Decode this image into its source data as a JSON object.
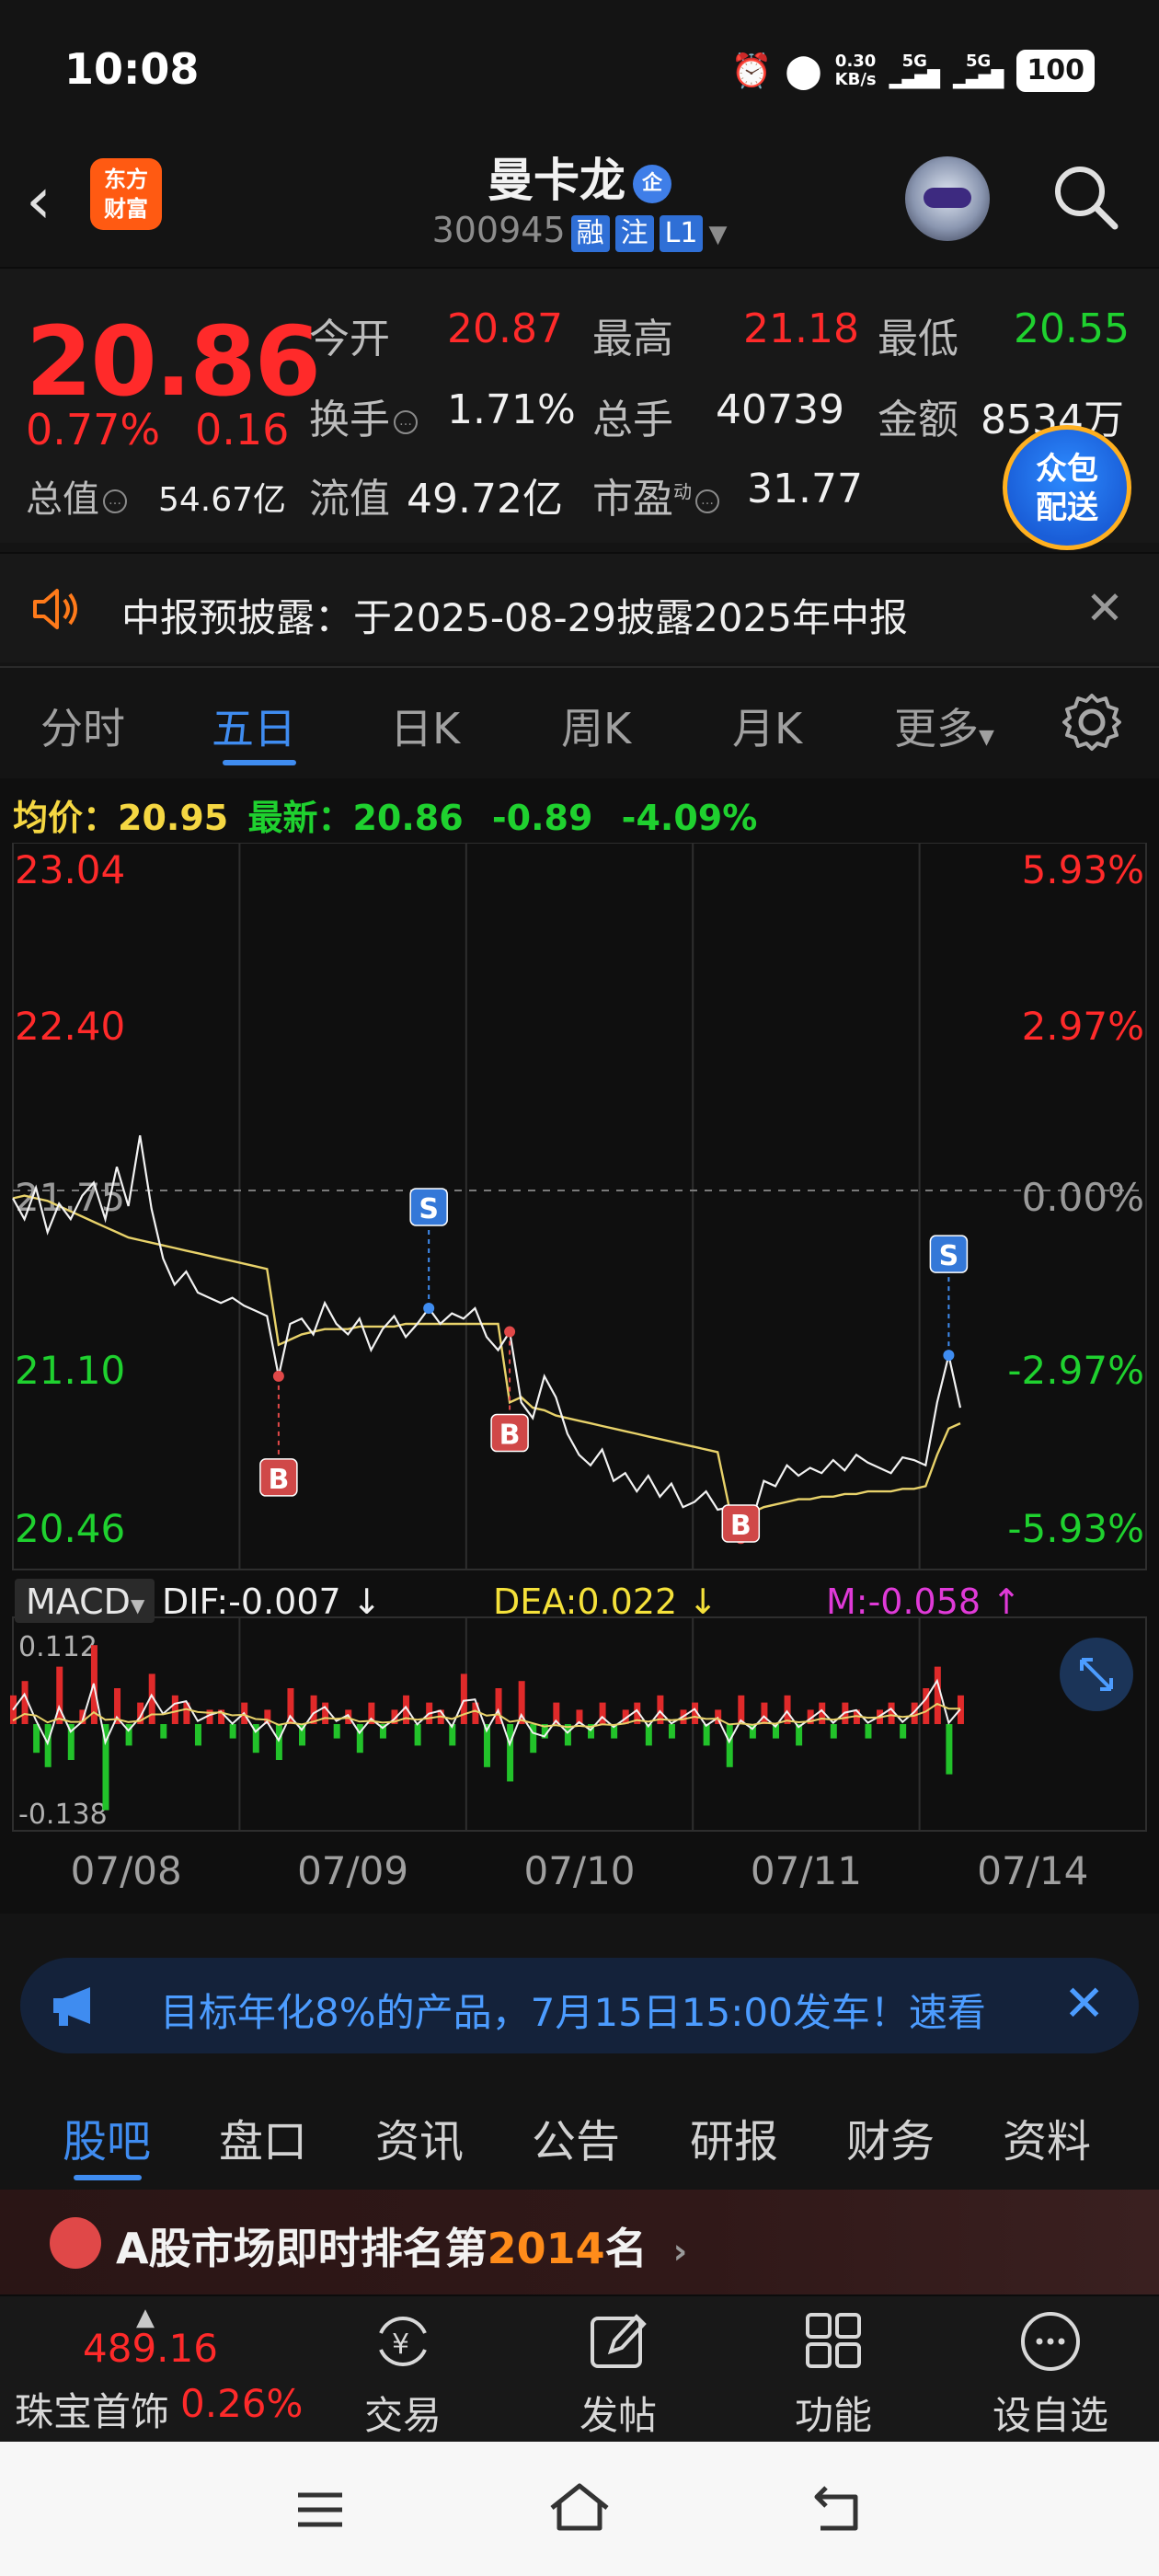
{
  "status_bar": {
    "time": "10:08",
    "net_speed_top": "0.30",
    "net_speed_unit": "KB/s",
    "signal1": "5G",
    "signal2": "5G",
    "battery": "100"
  },
  "header": {
    "logo_line1": "东方",
    "logo_line2": "财富",
    "stock_name": "曼卡龙",
    "name_badge": "企",
    "code": "300945",
    "tags": [
      "融",
      "注",
      "L1"
    ]
  },
  "quote": {
    "price": "20.86",
    "change_pct": "0.77%",
    "change": "0.16",
    "rows": [
      [
        {
          "label": "今开",
          "value": "20.87",
          "color": "#ff2a2a"
        },
        {
          "label": "最高",
          "value": "21.18",
          "color": "#ff2a2a"
        },
        {
          "label": "最低",
          "value": "20.55",
          "color": "#1fd12f"
        }
      ],
      [
        {
          "label": "换手",
          "value": "1.71%",
          "color": "#f0f0f0"
        },
        {
          "label": "总手",
          "value": "40739",
          "color": "#f0f0f0"
        },
        {
          "label": "金额",
          "value": "8534万",
          "color": "#f0f0f0"
        }
      ],
      [
        {
          "label": "总值",
          "value": "54.67亿",
          "color": "#f0f0f0"
        },
        {
          "label": "流值",
          "value": "49.72亿",
          "color": "#f0f0f0"
        },
        {
          "label": "市盈",
          "value": "31.77",
          "color": "#f0f0f0"
        }
      ]
    ],
    "pe_superscript": "动",
    "promo_line1": "众包",
    "promo_line2": "配送"
  },
  "notice": {
    "text": "中报预披露：于2025-08-29披露2025年中报"
  },
  "chart_tabs": {
    "items": [
      "分时",
      "五日",
      "日K",
      "周K",
      "月K",
      "更多"
    ],
    "active": "五日"
  },
  "summary": {
    "avg_label": "均价：",
    "avg_value": "20.95",
    "latest_label": "最新：",
    "latest_value": "20.86",
    "change": "-0.89",
    "change_pct": "-4.09%"
  },
  "macd": {
    "label": "MACD",
    "dif": "DIF:-0.007",
    "dea": "DEA:0.022",
    "m": "M:-0.058",
    "top_tick": "0.112",
    "bottom_tick": "-0.138"
  },
  "chart_data": {
    "type": "line",
    "left_ticks": [
      "23.04",
      "22.40",
      "21.75",
      "21.10",
      "20.46"
    ],
    "right_ticks": [
      "5.93%",
      "2.97%",
      "0.00%",
      "-2.97%",
      "-5.93%"
    ],
    "ylim": [
      20.46,
      23.04
    ],
    "x_labels": [
      "07/08",
      "07/09",
      "07/10",
      "07/11",
      "07/14"
    ],
    "series": [
      {
        "values": [
          21.78,
          21.7,
          21.82,
          21.65,
          21.76,
          21.7,
          21.79,
          21.84,
          21.7,
          21.9,
          21.75,
          22.02,
          21.74,
          21.55,
          21.45,
          21.5,
          21.42,
          21.4,
          21.38,
          21.4,
          21.37,
          21.35,
          21.33,
          21.1,
          21.3,
          21.32,
          21.26,
          21.38,
          21.3,
          21.26,
          21.32,
          21.2,
          21.28,
          21.33,
          21.25,
          21.3,
          21.36,
          21.3,
          21.34,
          21.32,
          21.36,
          21.25,
          21.2,
          21.27,
          21.0,
          20.94,
          21.1,
          21.02,
          20.88,
          20.8,
          20.76,
          20.82,
          20.7,
          20.73,
          20.66,
          20.72,
          20.64,
          20.69,
          20.6,
          20.62,
          20.66,
          20.59,
          20.6,
          20.48,
          20.55,
          20.7,
          20.68,
          20.76,
          20.72,
          20.75,
          20.73,
          20.78,
          20.74,
          20.8,
          20.77,
          20.75,
          20.73,
          20.79,
          20.78,
          20.76,
          21.0,
          21.18,
          20.98
        ]
      },
      {
        "values": [
          21.78,
          21.79,
          21.78,
          21.77,
          21.75,
          21.73,
          21.71,
          21.69,
          21.67,
          21.65,
          21.63,
          21.62,
          21.61,
          21.6,
          21.59,
          21.58,
          21.57,
          21.56,
          21.55,
          21.54,
          21.53,
          21.52,
          21.51,
          21.22,
          21.24,
          21.26,
          21.27,
          21.28,
          21.28,
          21.28,
          21.29,
          21.29,
          21.29,
          21.29,
          21.3,
          21.3,
          21.3,
          21.3,
          21.3,
          21.3,
          21.3,
          21.3,
          21.3,
          21.0,
          21.02,
          20.98,
          20.97,
          20.95,
          20.94,
          20.93,
          20.92,
          20.91,
          20.9,
          20.89,
          20.88,
          20.87,
          20.86,
          20.85,
          20.84,
          20.83,
          20.82,
          20.81,
          20.6,
          20.58,
          20.58,
          20.6,
          20.61,
          20.62,
          20.63,
          20.63,
          20.64,
          20.64,
          20.65,
          20.65,
          20.66,
          20.66,
          20.66,
          20.67,
          20.67,
          20.68,
          20.8,
          20.9,
          20.92
        ]
      }
    ],
    "trade_markers": [
      {
        "type": "B",
        "index": 23
      },
      {
        "type": "S",
        "index": 36
      },
      {
        "type": "B",
        "index": 43
      },
      {
        "type": "B",
        "index": 63
      },
      {
        "type": "S",
        "index": 81
      }
    ],
    "macd_bars": [
      0.04,
      0.06,
      -0.04,
      -0.06,
      0.08,
      -0.05,
      0.02,
      0.11,
      -0.12,
      0.05,
      -0.03,
      0.03,
      0.07,
      -0.02,
      0.04,
      0.03,
      -0.03,
      0.02,
      0.02,
      -0.02,
      0.03,
      -0.04,
      0.02,
      -0.05,
      0.05,
      -0.03,
      0.04,
      0.03,
      -0.02,
      0.02,
      -0.04,
      0.03,
      -0.02,
      0.02,
      0.04,
      -0.03,
      0.03,
      0.02,
      -0.03,
      0.07,
      0.03,
      -0.06,
      0.05,
      -0.08,
      0.06,
      -0.04,
      -0.02,
      0.03,
      -0.03,
      0.02,
      -0.02,
      0.03,
      -0.02,
      0.02,
      0.03,
      -0.03,
      0.04,
      -0.02,
      0.02,
      0.03,
      -0.03,
      0.02,
      -0.06,
      0.04,
      -0.02,
      0.03,
      -0.02,
      0.04,
      -0.03,
      0.02,
      0.03,
      -0.02,
      0.03,
      0.02,
      -0.02,
      0.02,
      0.03,
      -0.02,
      0.03,
      0.05,
      0.08,
      -0.07,
      0.04
    ]
  },
  "banner": {
    "text": "目标年化8%的产品，7月15日15:00发车！速看"
  },
  "sub_tabs": {
    "items": [
      "股吧",
      "盘口",
      "资讯",
      "公告",
      "研报",
      "财务",
      "资料"
    ],
    "active": "股吧"
  },
  "rank": {
    "prefix": "A股市场即时排名第",
    "number": "2014",
    "suffix": "名"
  },
  "toolbar": {
    "index_value": "489.16",
    "index_name": "珠宝首饰",
    "index_pct": "0.26%",
    "buttons": [
      "交易",
      "发帖",
      "功能",
      "设自选"
    ]
  }
}
